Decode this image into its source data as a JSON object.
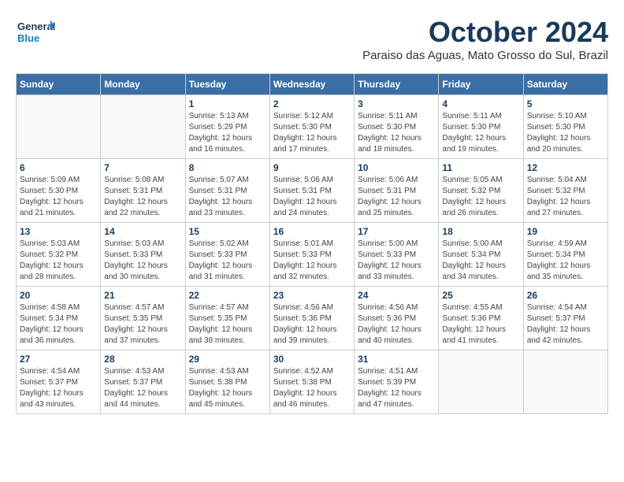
{
  "header": {
    "logo_general": "General",
    "logo_blue": "Blue",
    "month_title": "October 2024",
    "location": "Paraiso das Aguas, Mato Grosso do Sul, Brazil"
  },
  "weekdays": [
    "Sunday",
    "Monday",
    "Tuesday",
    "Wednesday",
    "Thursday",
    "Friday",
    "Saturday"
  ],
  "weeks": [
    [
      {
        "day": "",
        "info": ""
      },
      {
        "day": "",
        "info": ""
      },
      {
        "day": "1",
        "info": "Sunrise: 5:13 AM\nSunset: 5:29 PM\nDaylight: 12 hours and 16 minutes."
      },
      {
        "day": "2",
        "info": "Sunrise: 5:12 AM\nSunset: 5:30 PM\nDaylight: 12 hours and 17 minutes."
      },
      {
        "day": "3",
        "info": "Sunrise: 5:11 AM\nSunset: 5:30 PM\nDaylight: 12 hours and 18 minutes."
      },
      {
        "day": "4",
        "info": "Sunrise: 5:11 AM\nSunset: 5:30 PM\nDaylight: 12 hours and 19 minutes."
      },
      {
        "day": "5",
        "info": "Sunrise: 5:10 AM\nSunset: 5:30 PM\nDaylight: 12 hours and 20 minutes."
      }
    ],
    [
      {
        "day": "6",
        "info": "Sunrise: 5:09 AM\nSunset: 5:30 PM\nDaylight: 12 hours and 21 minutes."
      },
      {
        "day": "7",
        "info": "Sunrise: 5:08 AM\nSunset: 5:31 PM\nDaylight: 12 hours and 22 minutes."
      },
      {
        "day": "8",
        "info": "Sunrise: 5:07 AM\nSunset: 5:31 PM\nDaylight: 12 hours and 23 minutes."
      },
      {
        "day": "9",
        "info": "Sunrise: 5:06 AM\nSunset: 5:31 PM\nDaylight: 12 hours and 24 minutes."
      },
      {
        "day": "10",
        "info": "Sunrise: 5:06 AM\nSunset: 5:31 PM\nDaylight: 12 hours and 25 minutes."
      },
      {
        "day": "11",
        "info": "Sunrise: 5:05 AM\nSunset: 5:32 PM\nDaylight: 12 hours and 26 minutes."
      },
      {
        "day": "12",
        "info": "Sunrise: 5:04 AM\nSunset: 5:32 PM\nDaylight: 12 hours and 27 minutes."
      }
    ],
    [
      {
        "day": "13",
        "info": "Sunrise: 5:03 AM\nSunset: 5:32 PM\nDaylight: 12 hours and 28 minutes."
      },
      {
        "day": "14",
        "info": "Sunrise: 5:03 AM\nSunset: 5:33 PM\nDaylight: 12 hours and 30 minutes."
      },
      {
        "day": "15",
        "info": "Sunrise: 5:02 AM\nSunset: 5:33 PM\nDaylight: 12 hours and 31 minutes."
      },
      {
        "day": "16",
        "info": "Sunrise: 5:01 AM\nSunset: 5:33 PM\nDaylight: 12 hours and 32 minutes."
      },
      {
        "day": "17",
        "info": "Sunrise: 5:00 AM\nSunset: 5:33 PM\nDaylight: 12 hours and 33 minutes."
      },
      {
        "day": "18",
        "info": "Sunrise: 5:00 AM\nSunset: 5:34 PM\nDaylight: 12 hours and 34 minutes."
      },
      {
        "day": "19",
        "info": "Sunrise: 4:59 AM\nSunset: 5:34 PM\nDaylight: 12 hours and 35 minutes."
      }
    ],
    [
      {
        "day": "20",
        "info": "Sunrise: 4:58 AM\nSunset: 5:34 PM\nDaylight: 12 hours and 36 minutes."
      },
      {
        "day": "21",
        "info": "Sunrise: 4:57 AM\nSunset: 5:35 PM\nDaylight: 12 hours and 37 minutes."
      },
      {
        "day": "22",
        "info": "Sunrise: 4:57 AM\nSunset: 5:35 PM\nDaylight: 12 hours and 38 minutes."
      },
      {
        "day": "23",
        "info": "Sunrise: 4:56 AM\nSunset: 5:36 PM\nDaylight: 12 hours and 39 minutes."
      },
      {
        "day": "24",
        "info": "Sunrise: 4:56 AM\nSunset: 5:36 PM\nDaylight: 12 hours and 40 minutes."
      },
      {
        "day": "25",
        "info": "Sunrise: 4:55 AM\nSunset: 5:36 PM\nDaylight: 12 hours and 41 minutes."
      },
      {
        "day": "26",
        "info": "Sunrise: 4:54 AM\nSunset: 5:37 PM\nDaylight: 12 hours and 42 minutes."
      }
    ],
    [
      {
        "day": "27",
        "info": "Sunrise: 4:54 AM\nSunset: 5:37 PM\nDaylight: 12 hours and 43 minutes."
      },
      {
        "day": "28",
        "info": "Sunrise: 4:53 AM\nSunset: 5:37 PM\nDaylight: 12 hours and 44 minutes."
      },
      {
        "day": "29",
        "info": "Sunrise: 4:53 AM\nSunset: 5:38 PM\nDaylight: 12 hours and 45 minutes."
      },
      {
        "day": "30",
        "info": "Sunrise: 4:52 AM\nSunset: 5:38 PM\nDaylight: 12 hours and 46 minutes."
      },
      {
        "day": "31",
        "info": "Sunrise: 4:51 AM\nSunset: 5:39 PM\nDaylight: 12 hours and 47 minutes."
      },
      {
        "day": "",
        "info": ""
      },
      {
        "day": "",
        "info": ""
      }
    ]
  ]
}
